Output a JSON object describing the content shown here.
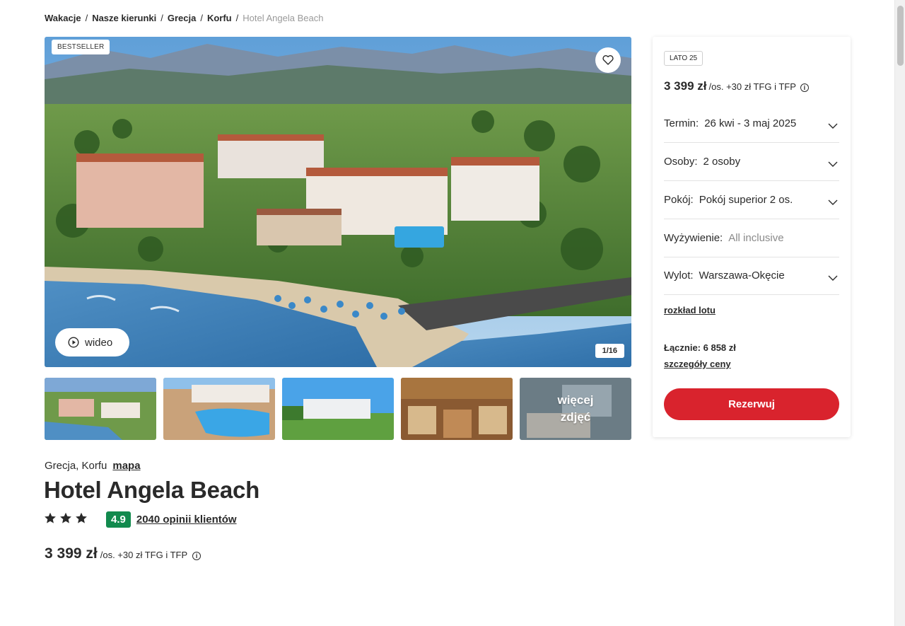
{
  "breadcrumb": {
    "items": [
      "Wakacje",
      "Nasze kierunki",
      "Grecja",
      "Korfu"
    ],
    "current": "Hotel Angela Beach",
    "separator": "/"
  },
  "gallery": {
    "badge": "BESTSELLER",
    "video_label": "wideo",
    "counter": "1/16",
    "more_label": "więcej zdjęć",
    "icons": {
      "favorite": "heart-icon",
      "video": "play-circle-icon"
    }
  },
  "hotel": {
    "location": "Grecja, Korfu",
    "map_link": "mapa",
    "title": "Hotel Angela Beach",
    "stars": 3,
    "score": "4.9",
    "reviews": "2040 opinii klientów",
    "price": "3 399 zł",
    "price_suffix": "/os. +30 zł TFG i TFP"
  },
  "booking": {
    "season_badge": "LATO 25",
    "price": "3 399 zł",
    "price_suffix": "/os. +30 zł TFG i TFP",
    "rows": [
      {
        "label": "Termin:",
        "value": "26 kwi - 3 maj 2025"
      },
      {
        "label": "Osoby:",
        "value": "2 osoby"
      },
      {
        "label": "Pokój:",
        "value": "Pokój superior 2 os."
      },
      {
        "label": "Wyżywienie:",
        "value": "All inclusive"
      },
      {
        "label": "Wylot:",
        "value": "Warszawa-Okęcie"
      }
    ],
    "flight_schedule": "rozkład lotu",
    "total": "Łącznie: 6 858 zł",
    "price_details": "szczegóły ceny",
    "book_button": "Rezerwuj"
  },
  "colors": {
    "accent": "#d9232d",
    "score_bg": "#128a4e",
    "text": "#2a2a2a",
    "muted": "#9a9a9a"
  },
  "info_glyph": "i"
}
